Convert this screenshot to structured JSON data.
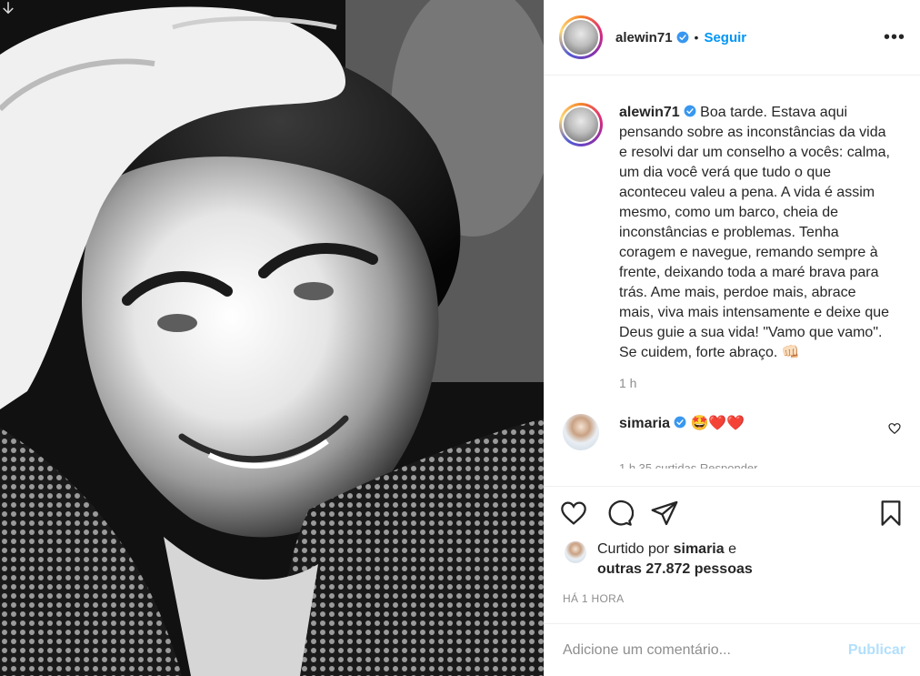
{
  "post": {
    "author": "alewin71",
    "follow_label": "Seguir",
    "dot": "•",
    "more_label": "•••"
  },
  "caption": {
    "username": "alewin71",
    "text": "Boa tarde. Estava aqui pensando sobre as inconstâncias da vida e resolvi dar um conselho a vocês: calma, um dia você verá que tudo o que aconteceu valeu a pena. A vida é assim mesmo, como um barco, cheia de inconstâncias e problemas. Tenha coragem e navegue, remando sempre à frente, deixando toda a maré brava para trás. Ame mais, perdoe mais, abrace mais, viva mais intensamente e deixe que Deus guie a sua vida! \"Vamo que vamo\". Se cuidem, forte abraço. 👊🏻",
    "time": "1 h"
  },
  "comments": [
    {
      "username": "simaria",
      "text": "🤩❤️❤️",
      "meta": "1 h   35 curtidas   Responder"
    }
  ],
  "likes": {
    "prefix": "Curtido por",
    "user": "simaria",
    "conj": "e",
    "others": "outras 27.872 pessoas"
  },
  "timestamp": "HÁ 1 HORA",
  "comment_input": {
    "placeholder": "Adicione um comentário...",
    "publish_label": "Publicar"
  },
  "colors": {
    "accent": "#0095f6",
    "publish_disabled": "#b2dffc",
    "muted": "#8e8e8e"
  }
}
